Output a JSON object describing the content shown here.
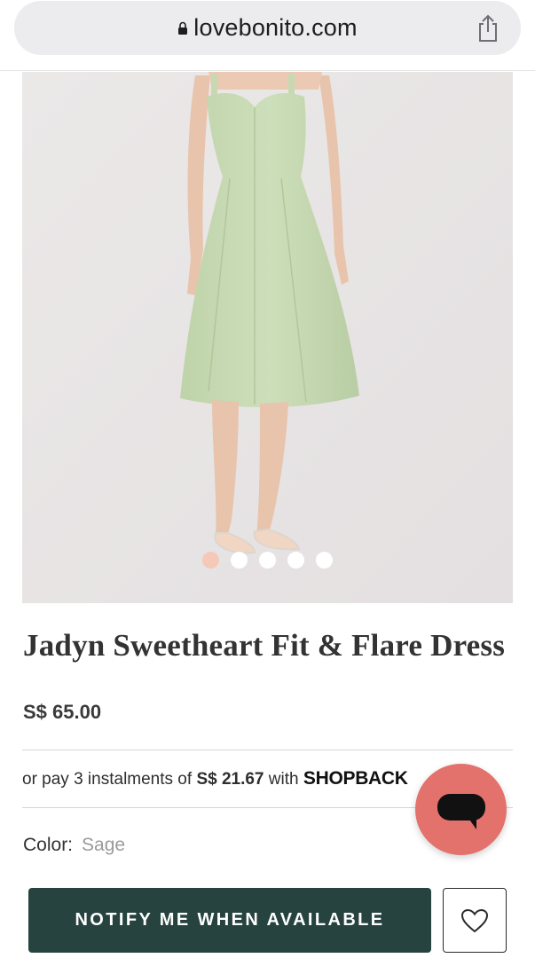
{
  "browser": {
    "url": "lovebonito.com",
    "icons": {
      "lock": "lock-icon",
      "share": "share-icon"
    }
  },
  "product": {
    "title": "Jadyn Sweetheart Fit & Flare Dress",
    "price": "S$ 65.00",
    "image_carousel": {
      "count": 5,
      "active_index": 0
    }
  },
  "installments": {
    "prefix": "or pay 3 instalments of ",
    "amount": "S$ 21.67",
    "with": " with ",
    "provider": "SHOPBACK"
  },
  "color": {
    "label": "Color:",
    "value": "Sage"
  },
  "actions": {
    "notify_label": "NOTIFY ME WHEN AVAILABLE",
    "wishlist_icon": "heart-icon",
    "chat_icon": "chat-bubble-icon"
  },
  "colors": {
    "primary_button": "#26433f",
    "chat_bubble": "#e3716c",
    "active_dot": "#f4c9b8",
    "dress": "#c9dbb6"
  }
}
